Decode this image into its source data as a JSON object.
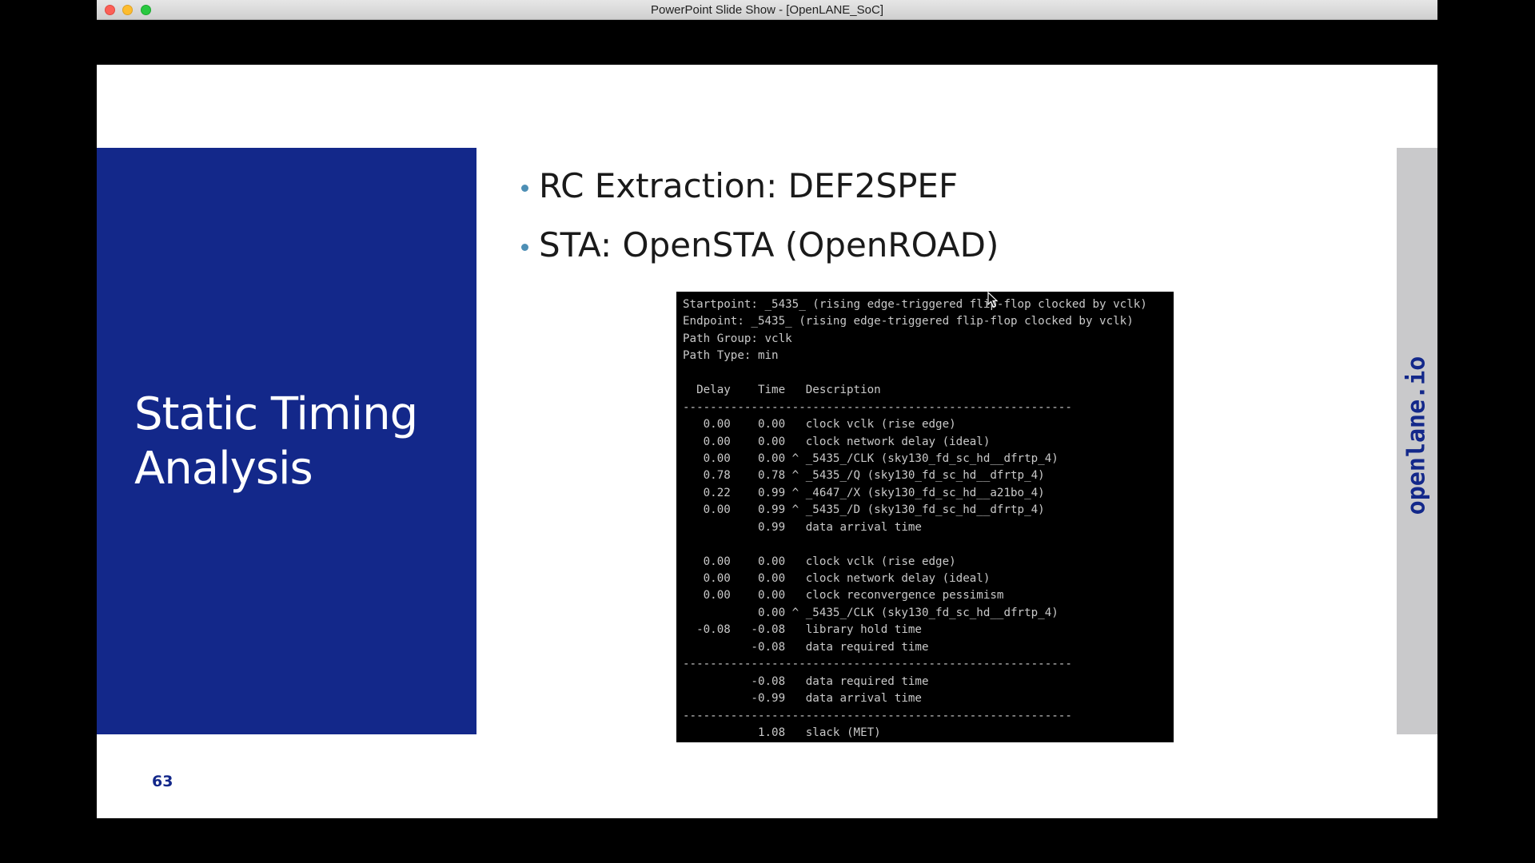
{
  "window": {
    "title": "PowerPoint Slide Show - [OpenLANE_SoC]",
    "buttons": [
      "close",
      "minimize",
      "maximize"
    ]
  },
  "slide": {
    "panel_title_line1": "Static Timing",
    "panel_title_line2": "Analysis",
    "bullets": [
      "RC Extraction: DEF2SPEF",
      "STA: OpenSTA (OpenROAD)"
    ],
    "terminal_lines": [
      "Startpoint: _5435_ (rising edge-triggered flip-flop clocked by vclk)",
      "Endpoint: _5435_ (rising edge-triggered flip-flop clocked by vclk)",
      "Path Group: vclk",
      "Path Type: min",
      "",
      "  Delay    Time   Description",
      "---------------------------------------------------------",
      "   0.00    0.00   clock vclk (rise edge)",
      "   0.00    0.00   clock network delay (ideal)",
      "   0.00    0.00 ^ _5435_/CLK (sky130_fd_sc_hd__dfrtp_4)",
      "   0.78    0.78 ^ _5435_/Q (sky130_fd_sc_hd__dfrtp_4)",
      "   0.22    0.99 ^ _4647_/X (sky130_fd_sc_hd__a21bo_4)",
      "   0.00    0.99 ^ _5435_/D (sky130_fd_sc_hd__dfrtp_4)",
      "           0.99   data arrival time",
      "",
      "   0.00    0.00   clock vclk (rise edge)",
      "   0.00    0.00   clock network delay (ideal)",
      "   0.00    0.00   clock reconvergence pessimism",
      "           0.00 ^ _5435_/CLK (sky130_fd_sc_hd__dfrtp_4)",
      "  -0.08   -0.08   library hold time",
      "          -0.08   data required time",
      "---------------------------------------------------------",
      "          -0.08   data required time",
      "          -0.99   data arrival time",
      "---------------------------------------------------------",
      "           1.08   slack (MET)"
    ],
    "side_strip_text": "openlane.io",
    "page_number": "63"
  },
  "colors": {
    "panel_blue": "#13288a",
    "bullet_dot": "#4d8fb5",
    "terminal_bg": "#000000",
    "terminal_text": "#c9c9c9",
    "side_strip": "#c9c9cb"
  }
}
